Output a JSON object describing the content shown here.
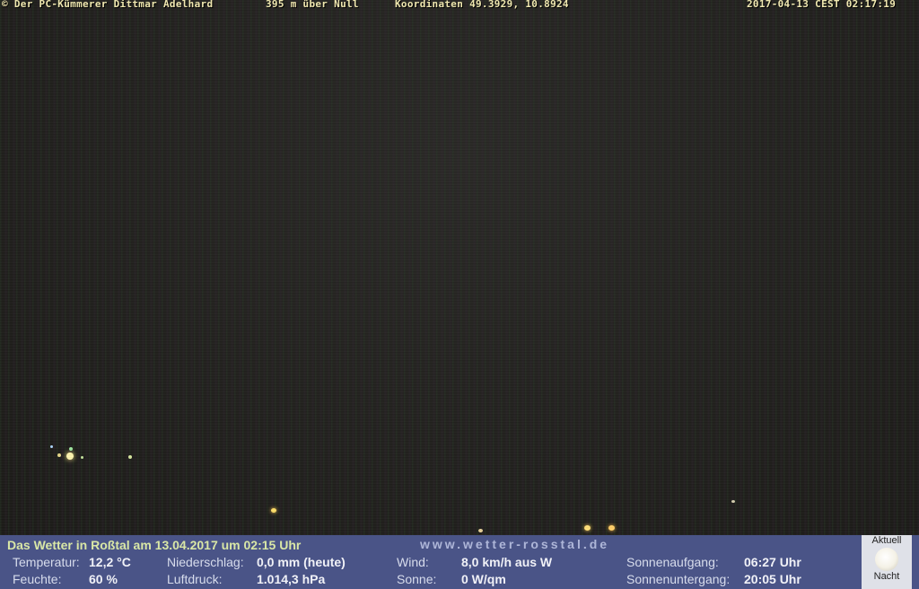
{
  "overlay": {
    "copyright": "© Der PC-Kümmerer Dittmar Adelhard",
    "elevation": "395 m über Null",
    "coordinates": "Koordinaten 49.3929, 10.8924",
    "timestamp": "2017-04-13 CEST 02:17:19"
  },
  "weather": {
    "headline": "Das Wetter in Roßtal am 13.04.2017 um 02:15 Uhr",
    "url": "www.wetter-rosstal.de",
    "temperature_label": "Temperatur:",
    "temperature_value": "12,2 °C",
    "humidity_label": "Feuchte:",
    "humidity_value": "60 %",
    "precip_label": "Niederschlag:",
    "precip_value": "0,0 mm (heute)",
    "pressure_label": "Luftdruck:",
    "pressure_value": "1.014,3 hPa",
    "wind_label": "Wind:",
    "wind_value": "8,0 km/h aus W",
    "sun_label": "Sonne:",
    "sun_value": "0 W/qm",
    "sunrise_label": "Sonnenaufgang:",
    "sunrise_value": "06:27 Uhr",
    "sunset_label": "Sonnenuntergang:",
    "sunset_value": "20:05 Uhr"
  },
  "moon": {
    "top_label": "Aktuell",
    "bottom_label": "Nacht",
    "icon": "full-moon-icon"
  }
}
